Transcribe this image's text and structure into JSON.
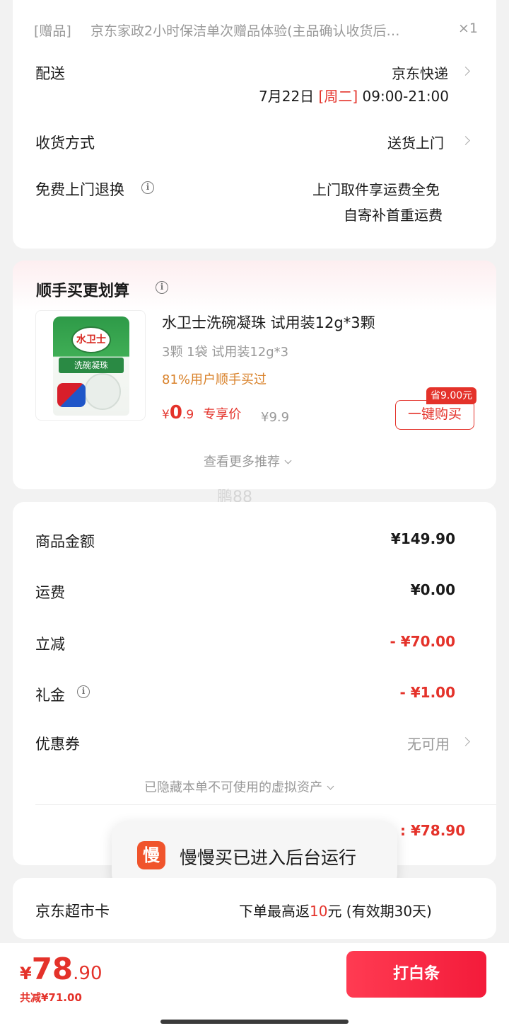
{
  "gift": {
    "tag": "[赠品]",
    "title": "京东家政2小时保洁单次赠品体验(主品确认收货后…",
    "qty": "×1"
  },
  "delivery": {
    "label": "配送",
    "carrier": "京东快递",
    "date": "7月22日",
    "weekday": "[周二]",
    "time": "09:00-21:00"
  },
  "receive": {
    "label": "收货方式",
    "value": "送货上门"
  },
  "free_return": {
    "label": "免费上门退换",
    "line1": "上门取件享运费全免",
    "line2": "自寄补首重运费"
  },
  "recommend": {
    "title": "顺手买更划算",
    "product": {
      "name": "水卫士洗碗凝珠 试用装12g*3颗",
      "spec": "3颗 1袋 试用装12g*3",
      "social": "81%用户顺手买过",
      "currency": "¥",
      "price_int": "0",
      "price_dec": ".9",
      "price_label": "专享价",
      "orig_price": "¥9.9",
      "save_tag": "省9.00元",
      "buy_label": "一键购买",
      "image_logo": "水卫士",
      "image_band": "洗碗凝珠"
    },
    "more": "查看更多推荐"
  },
  "watermark": "鹏88",
  "summary": {
    "goods_label": "商品金额",
    "goods_value": "¥149.90",
    "ship_label": "运费",
    "ship_value": "¥0.00",
    "discount_label": "立减",
    "discount_value": "- ¥70.00",
    "gift_label": "礼金",
    "gift_value": "- ¥1.00",
    "coupon_label": "优惠券",
    "coupon_value": "无可用",
    "hidden_assets": "已隐藏本单不可使用的虚拟资产",
    "total_partial": ": ¥78.90"
  },
  "toast": {
    "icon_char": "慢",
    "text": "慢慢买已进入后台运行"
  },
  "supermarket": {
    "label": "京东超市卡",
    "pre": "下单最高返",
    "amount": "10",
    "post": "元 (有效期30天)"
  },
  "footer": {
    "currency": "¥",
    "total_int": "78",
    "total_dec": ".90",
    "saved": "共减¥71.00",
    "pay_label": "打白条"
  },
  "colors": {
    "accent": "#e4322a",
    "pay_button": "#f31b3a",
    "orange": "#d9822b"
  }
}
